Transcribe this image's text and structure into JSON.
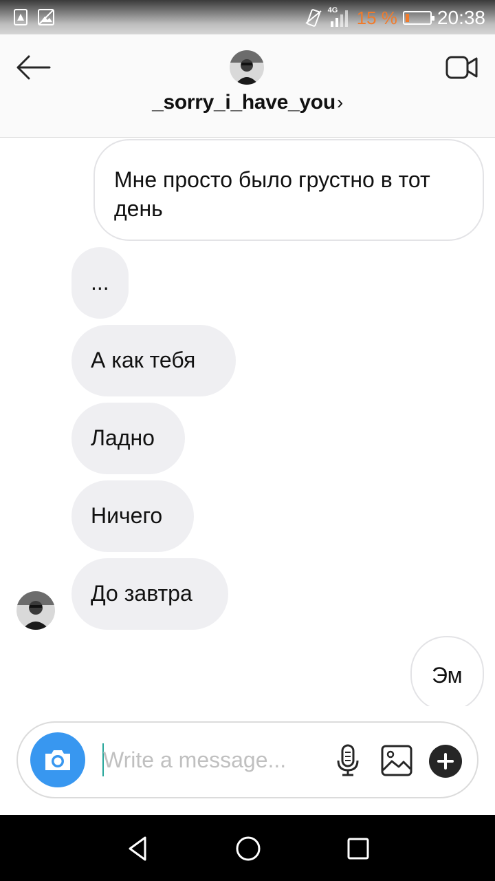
{
  "status_bar": {
    "network": "4G",
    "battery_percent": "15 %",
    "battery_level": 0.15,
    "time": "20:38",
    "icons": [
      "warning-sim-icon",
      "no-image-icon",
      "vibrate-icon",
      "signal-icon",
      "battery-icon"
    ],
    "accent_color": "#f07b2c"
  },
  "header": {
    "username": "_sorry_i_have_you",
    "chevron": "›",
    "back_icon": "arrow-left-icon",
    "video_icon": "video-camera-icon"
  },
  "messages": [
    {
      "direction": "sent",
      "text": "Мне просто было грустно в тот день"
    },
    {
      "direction": "received",
      "text": "..."
    },
    {
      "direction": "received",
      "text": "А как тебя"
    },
    {
      "direction": "received",
      "text": "Ладно"
    },
    {
      "direction": "received",
      "text": "Ничего"
    },
    {
      "direction": "received",
      "text": "До завтра"
    },
    {
      "direction": "sent",
      "text": "Эм"
    }
  ],
  "composer": {
    "placeholder": "Write a message...",
    "value": "",
    "camera_icon": "camera-icon",
    "mic_icon": "microphone-icon",
    "gallery_icon": "gallery-icon",
    "plus_icon": "plus-icon",
    "camera_color": "#3897f0"
  },
  "nav_bar": {
    "icons": [
      "back-triangle-icon",
      "home-circle-icon",
      "recents-square-icon"
    ]
  }
}
